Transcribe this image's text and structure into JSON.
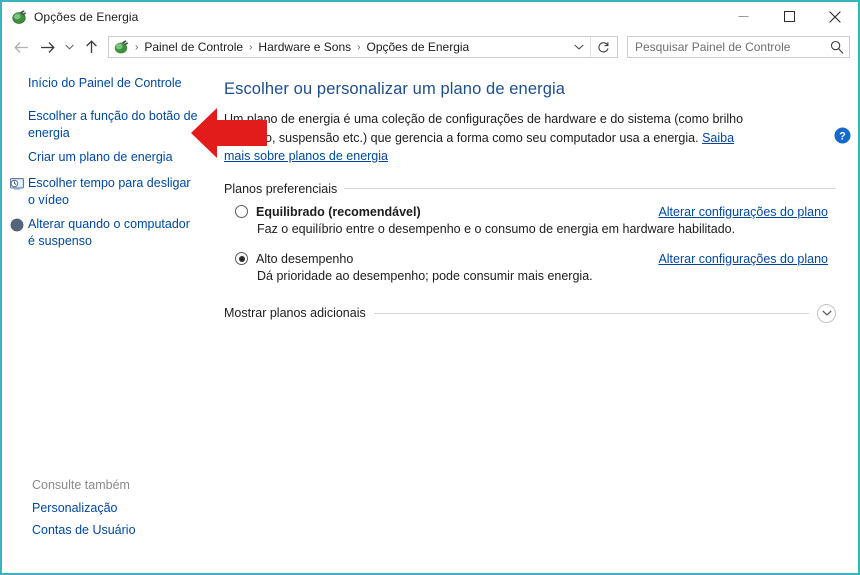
{
  "window": {
    "title": "Opções de Energia",
    "title_icon": "power-plug-icon",
    "controls": {
      "minimize": "minimize-button",
      "maximize": "maximize-button",
      "close": "close-button"
    }
  },
  "navbar": {
    "back": "back-arrow-icon",
    "forward": "forward-arrow-icon",
    "recent": "recent-locations-chevron-icon",
    "up": "up-arrow-icon",
    "breadcrumb_icon": "control-panel-icon",
    "breadcrumbs": [
      "Painel de Controle",
      "Hardware e Sons",
      "Opções de Energia"
    ],
    "separator": "›",
    "dropdown": "address-dropdown-icon",
    "refresh": "refresh-icon"
  },
  "search": {
    "placeholder": "Pesquisar Painel de Controle",
    "value": "",
    "icon": "search-icon"
  },
  "sidebar": {
    "home_link": "Início do Painel de Controle",
    "items": [
      {
        "label": "Escolher a função do botão de energia",
        "icon": null
      },
      {
        "label": "Criar um plano de energia",
        "icon": null
      },
      {
        "label": "Escolher tempo para desligar o vídeo",
        "icon": "monitor-clock-icon"
      },
      {
        "label": "Alterar quando o computador é suspenso",
        "icon": "sleep-moon-icon"
      }
    ],
    "see_also": {
      "title": "Consulte também",
      "links": [
        "Personalização",
        "Contas de Usuário"
      ]
    }
  },
  "main": {
    "title": "Escolher ou personalizar um plano de energia",
    "description_prefix": "Um plano de energia é uma coleção de configurações de hardware e do sistema (como brilho do vídeo, suspensão etc.) que gerencia a forma como seu computador usa a energia. ",
    "description_link": "Saiba mais sobre planos de energia",
    "group_label": "Planos preferenciais",
    "plans": [
      {
        "name": "Equilibrado (recomendável)",
        "selected": false,
        "bold": true,
        "description": "Faz o equilíbrio entre o desempenho e o consumo de energia em hardware habilitado.",
        "change_link": "Alterar configurações do plano"
      },
      {
        "name": "Alto desempenho",
        "selected": true,
        "bold": false,
        "description": "Dá prioridade ao desempenho; pode consumir mais energia.",
        "change_link": "Alterar configurações do plano"
      }
    ],
    "expander_label": "Mostrar planos adicionais",
    "expander_icon": "chevron-down-icon",
    "help_icon": "help-question-icon"
  },
  "annotation": {
    "arrow": "red-left-arrow-annotation"
  },
  "colors": {
    "window_border": "#3ab3bd",
    "link": "#00479b",
    "heading": "#1f4e8c",
    "annotation_red": "#e21b1b",
    "help_blue": "#1569c7"
  }
}
